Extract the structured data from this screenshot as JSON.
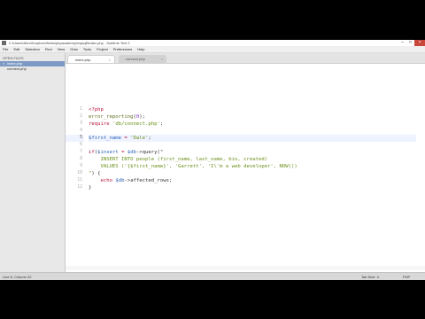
{
  "window": {
    "title": "C:\\Users\\Alex\\Dropbox\\Webs\\phpacademy\\mysqli\\index.php - Sublime Text 2",
    "controls": [
      "–",
      "□",
      "×"
    ]
  },
  "menu": [
    "File",
    "Edit",
    "Selection",
    "Find",
    "View",
    "Goto",
    "Tools",
    "Project",
    "Preferences",
    "Help"
  ],
  "sidebar": {
    "header": "OPEN FILES",
    "files": [
      {
        "label": "index.php",
        "active": true,
        "close": "×"
      },
      {
        "label": "connect.php",
        "active": false,
        "close": ""
      }
    ]
  },
  "tabs": [
    {
      "label": "index.php",
      "close": "×"
    },
    {
      "label": "connect.php",
      "close": "×"
    }
  ],
  "editor": {
    "current_line": 5,
    "lines": [
      [
        [
          "kw",
          "<?php"
        ]
      ],
      [
        [
          "fn",
          "error_reporting"
        ],
        [
          "",
          "("
        ],
        [
          "num",
          "0"
        ],
        [
          "",
          ");"
        ]
      ],
      [
        [
          "kw",
          "require"
        ],
        [
          "",
          " "
        ],
        [
          "str",
          "'db/connect.php'"
        ],
        [
          "",
          ";"
        ]
      ],
      [
        [
          "",
          ""
        ]
      ],
      [
        [
          "var",
          "$first_name"
        ],
        [
          "",
          " "
        ],
        [
          "op",
          "="
        ],
        [
          "",
          " "
        ],
        [
          "str",
          "'Dale'"
        ],
        [
          "",
          ";"
        ]
      ],
      [
        [
          "",
          ""
        ]
      ],
      [
        [
          "kw",
          "if"
        ],
        [
          "",
          "("
        ],
        [
          "var",
          "$insert"
        ],
        [
          "",
          " "
        ],
        [
          "op",
          "="
        ],
        [
          "",
          " "
        ],
        [
          "var",
          "$db"
        ],
        [
          "",
          "->query(\""
        ]
      ],
      [
        [
          "str",
          "    INSERT INTO people (first_name, last_name, bio, created)"
        ]
      ],
      [
        [
          "str",
          "    VALUES ('{$first_name}', 'Garrett', 'I\\'m a web developer', NOW())"
        ]
      ],
      [
        [
          "str",
          "\""
        ],
        [
          "",
          ") {"
        ]
      ],
      [
        [
          "",
          ""
        ],
        [
          "",
          "    "
        ],
        [
          "kw",
          "echo"
        ],
        [
          "",
          " "
        ],
        [
          "var",
          "$db"
        ],
        [
          "",
          "->affected_rows;"
        ]
      ],
      [
        [
          "",
          "}"
        ]
      ]
    ]
  },
  "status": {
    "position": "Line 5, Column 22",
    "tab_size": "Tab Size: 4",
    "syntax": "PHP"
  },
  "colors": {
    "keyword": "#b5173c",
    "string": "#6a8f1a",
    "variable": "#2d63b8",
    "function": "#5a6f1c",
    "number": "#8c3ad1",
    "sidebar_selection": "#7d9ac4"
  }
}
